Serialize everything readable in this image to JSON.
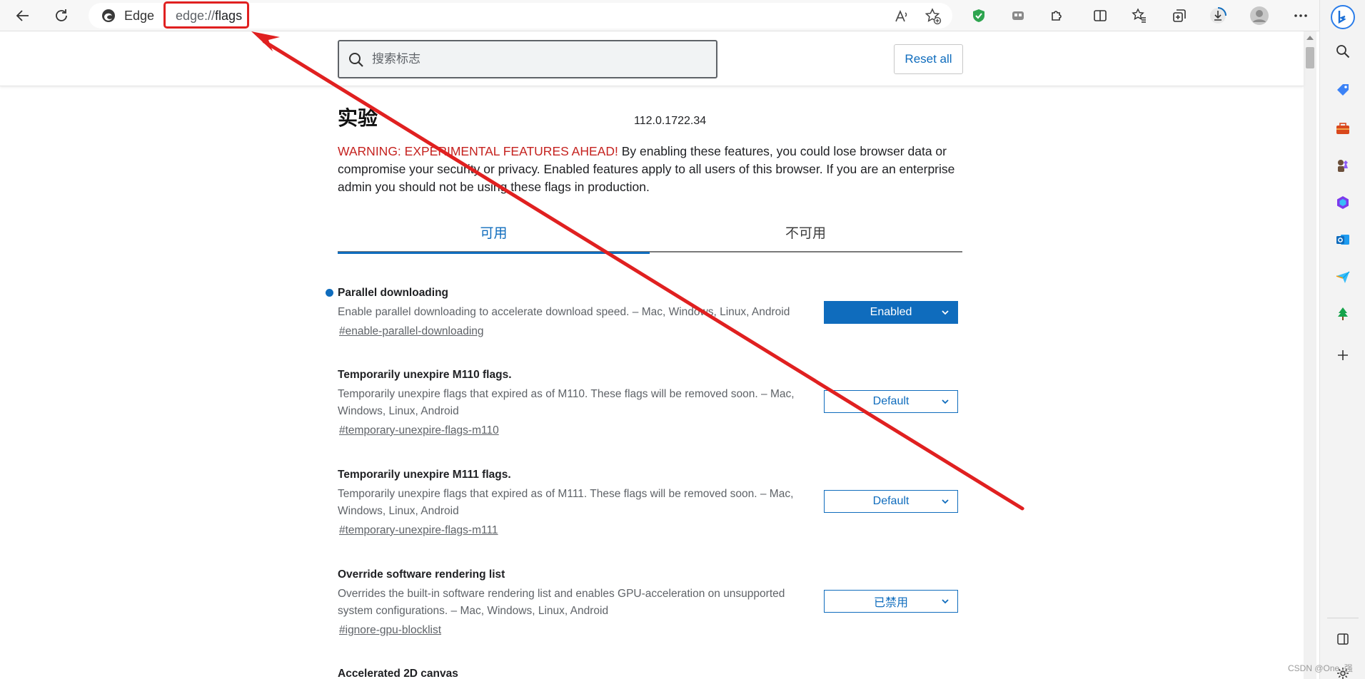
{
  "browser": {
    "brand_label": "Edge",
    "url_scheme": "edge://",
    "url_path": "flags"
  },
  "search": {
    "placeholder": "搜索标志",
    "value": ""
  },
  "header": {
    "reset_label": "Reset all"
  },
  "page": {
    "title": "实验",
    "version": "112.0.1722.34",
    "warning_prefix": "WARNING: EXPERIMENTAL FEATURES AHEAD!",
    "warning_body": " By enabling these features, you could lose browser data or compromise your security or privacy. Enabled features apply to all users of this browser. If you are an enterprise admin you should not be using these flags in production."
  },
  "tabs": [
    {
      "label": "可用",
      "active": true
    },
    {
      "label": "不可用",
      "active": false
    }
  ],
  "flags": [
    {
      "title": "Parallel downloading",
      "description": "Enable parallel downloading to accelerate download speed. – Mac, Windows, Linux, Android",
      "link": "#enable-parallel-downloading",
      "value": "Enabled",
      "modified": true
    },
    {
      "title": "Temporarily unexpire M110 flags.",
      "description": "Temporarily unexpire flags that expired as of M110. These flags will be removed soon. – Mac, Windows, Linux, Android",
      "link": "#temporary-unexpire-flags-m110",
      "value": "Default",
      "modified": false
    },
    {
      "title": "Temporarily unexpire M111 flags.",
      "description": "Temporarily unexpire flags that expired as of M111. These flags will be removed soon. – Mac, Windows, Linux, Android",
      "link": "#temporary-unexpire-flags-m111",
      "value": "Default",
      "modified": false
    },
    {
      "title": "Override software rendering list",
      "description": "Overrides the built-in software rendering list and enables GPU-acceleration on unsupported system configurations. – Mac, Windows, Linux, Android",
      "link": "#ignore-gpu-blocklist",
      "value": "已禁用",
      "modified": false
    },
    {
      "title": "Accelerated 2D canvas",
      "description": "",
      "link": "",
      "value": "",
      "modified": false
    }
  ],
  "watermark": "CSDN @One_强",
  "colors": {
    "accent": "#0f6cbd",
    "warning": "#c5221f",
    "annotation": "#e02020"
  }
}
